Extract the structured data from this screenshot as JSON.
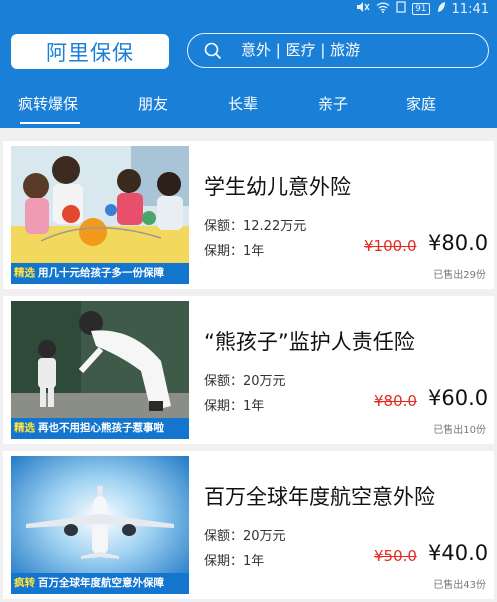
{
  "status": {
    "battery": "91",
    "time": "11:41"
  },
  "header": {
    "brand": "阿里保保",
    "search_text": "意外 | 医疗 | 旅游"
  },
  "tabs": [
    {
      "label": "疯转爆保"
    },
    {
      "label": "朋友"
    },
    {
      "label": "长辈"
    },
    {
      "label": "亲子"
    },
    {
      "label": "家庭"
    }
  ],
  "products": [
    {
      "title": "学生幼儿意外险",
      "coverage": "保额：12.22万元",
      "term": "保期：1年",
      "old_price": "¥100.0",
      "price": "¥80.0",
      "sold": "已售出29份",
      "tag": "精选",
      "caption": "用几十元给孩子多一份保障"
    },
    {
      "title": "“熊孩子”监护人责任险",
      "coverage": "保额：20万元",
      "term": "保期：1年",
      "old_price": "¥80.0",
      "price": "¥60.0",
      "sold": "已售出10份",
      "tag": "精选",
      "caption": "再也不用担心熊孩子惹事啦"
    },
    {
      "title": "百万全球年度航空意外险",
      "coverage": "保额：20万元",
      "term": "保期：1年",
      "old_price": "¥50.0",
      "price": "¥40.0",
      "sold": "已售出43份",
      "tag": "疯转",
      "caption": "百万全球年度航空意外保障"
    }
  ],
  "colors": {
    "primary": "#1a7fd6",
    "old_price": "#e52a23",
    "tag": "#ffe43a"
  }
}
